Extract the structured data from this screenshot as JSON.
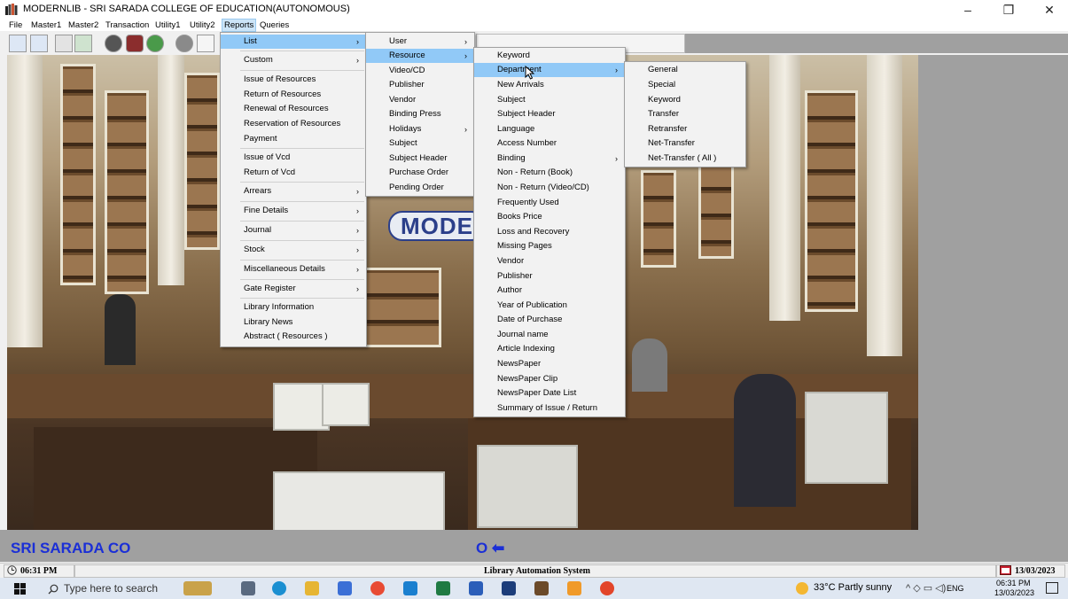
{
  "window": {
    "title": "MODERNLIB - SRI SARADA COLLEGE OF EDUCATION(AUTONOMOUS)",
    "minimize_glyph": "–",
    "restore_glyph": "❐",
    "close_glyph": "✕"
  },
  "menubar": [
    "File",
    "Master1",
    "Master2",
    "Transaction",
    "Utility1",
    "Utility2",
    "Reports",
    "Queries"
  ],
  "logo_text": "MODE",
  "marquee": {
    "text": "SRI SARADA CO",
    "tail": "O ⬅"
  },
  "statusbar": {
    "time": "06:31 PM",
    "center": "Library Automation System",
    "date": "13/03/2023"
  },
  "taskbar": {
    "search_placeholder": "Type here to search",
    "weather": "33°C  Partly sunny",
    "lang": "ENG",
    "clock_time": "06:31 PM",
    "clock_date": "13/03/2023"
  },
  "reports_menu": [
    {
      "label": "List",
      "arrow": true
    },
    {
      "label": "Custom",
      "arrow": true
    },
    {
      "label": "Issue of Resources"
    },
    {
      "label": "Return of Resources"
    },
    {
      "label": "Renewal of Resources"
    },
    {
      "label": "Reservation of Resources"
    },
    {
      "label": "Payment"
    },
    {
      "label": "Issue of Vcd"
    },
    {
      "label": "Return of Vcd"
    },
    {
      "label": "Arrears",
      "arrow": true
    },
    {
      "label": "Fine Details",
      "arrow": true
    },
    {
      "label": "Journal",
      "arrow": true
    },
    {
      "label": "Stock",
      "arrow": true
    },
    {
      "label": "Miscellaneous Details",
      "arrow": true
    },
    {
      "label": "Gate Register",
      "arrow": true
    },
    {
      "label": "Library Information"
    },
    {
      "label": "Library News"
    },
    {
      "label": "Abstract ( Resources )"
    }
  ],
  "list_menu": [
    {
      "label": "User",
      "arrow": true
    },
    {
      "label": "Resource",
      "arrow": true
    },
    {
      "label": "Video/CD"
    },
    {
      "label": "Publisher"
    },
    {
      "label": "Vendor"
    },
    {
      "label": "Binding Press"
    },
    {
      "label": "Holidays",
      "arrow": true
    },
    {
      "label": "Subject"
    },
    {
      "label": "Subject Header"
    },
    {
      "label": "Purchase Order"
    },
    {
      "label": "Pending Order"
    }
  ],
  "resource_menu": [
    {
      "label": "Keyword"
    },
    {
      "label": "Department",
      "arrow": true
    },
    {
      "label": "New Arrivals"
    },
    {
      "label": "Subject"
    },
    {
      "label": "Subject Header"
    },
    {
      "label": "Language"
    },
    {
      "label": "Access Number"
    },
    {
      "label": "Binding",
      "arrow": true
    },
    {
      "label": "Non - Return (Book)"
    },
    {
      "label": "Non - Return (Video/CD)"
    },
    {
      "label": "Frequently Used"
    },
    {
      "label": "Books Price"
    },
    {
      "label": "Loss and Recovery"
    },
    {
      "label": "Missing Pages"
    },
    {
      "label": "Vendor"
    },
    {
      "label": "Publisher"
    },
    {
      "label": "Author"
    },
    {
      "label": "Year of Publication"
    },
    {
      "label": "Date of Purchase"
    },
    {
      "label": "Journal name"
    },
    {
      "label": "Article Indexing"
    },
    {
      "label": "NewsPaper"
    },
    {
      "label": "NewsPaper Clip"
    },
    {
      "label": "NewsPaper Date List"
    },
    {
      "label": "Summary of Issue / Return"
    }
  ],
  "department_menu": [
    {
      "label": "General"
    },
    {
      "label": "Special"
    },
    {
      "label": "Keyword"
    },
    {
      "label": "Transfer"
    },
    {
      "label": "Retransfer"
    },
    {
      "label": "Net-Transfer"
    },
    {
      "label": "Net-Transfer ( All )"
    }
  ],
  "colors": {
    "highlight": "#91c9f7",
    "marquee_text": "#1b2fd6",
    "taskbar": "#dfe7f2"
  }
}
